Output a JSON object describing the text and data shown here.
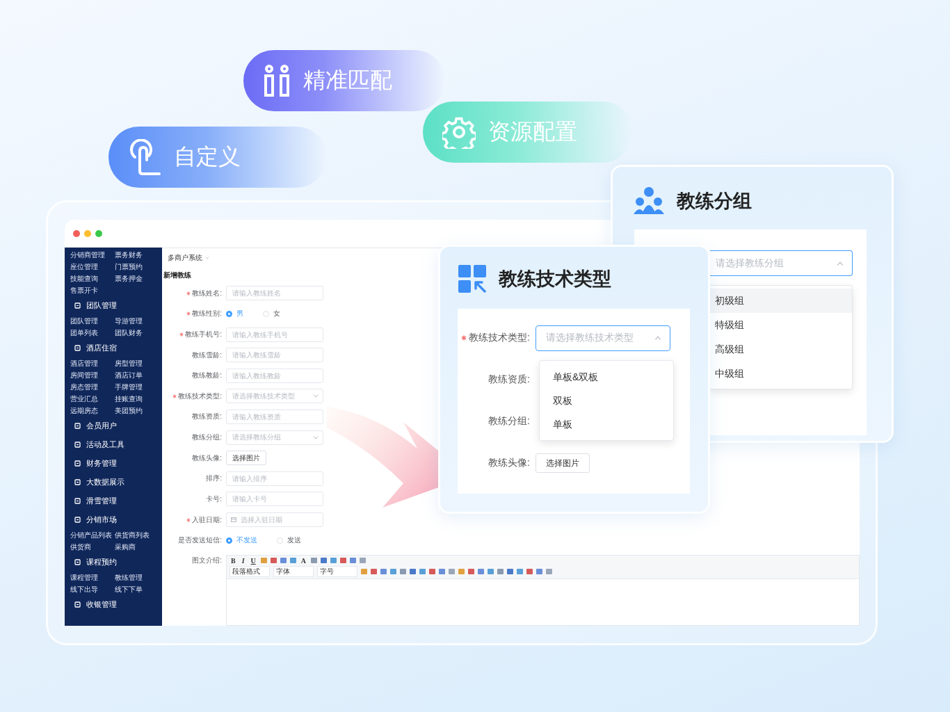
{
  "badges": [
    {
      "kind": "match",
      "label": "精准匹配"
    },
    {
      "kind": "gear",
      "label": "资源配置"
    },
    {
      "kind": "touch",
      "label": "自定义"
    }
  ],
  "app": {
    "sidebar": [
      {
        "items": [
          "分销商管理",
          "票务财务",
          "座位管理",
          "门票预约",
          "技能查询",
          "票务押金",
          "售票开卡"
        ]
      },
      {
        "title": "团队管理",
        "items": [
          "团队管理",
          "导游管理",
          "团单列表",
          "团队财务"
        ]
      },
      {
        "title": "酒店住宿",
        "items": [
          "酒店管理",
          "房型管理",
          "房间管理",
          "酒店订单",
          "房态管理",
          "手牌管理",
          "营业汇总",
          "挂账查询",
          "远期房态",
          "美团预约"
        ]
      },
      {
        "title": "会员用户"
      },
      {
        "title": "活动及工具"
      },
      {
        "title": "财务管理"
      },
      {
        "title": "大数据展示"
      },
      {
        "title": "滑雪管理"
      },
      {
        "title": "分销市场",
        "items": [
          "分销产品列表",
          "供货商列表",
          "供货商",
          "采购商"
        ]
      },
      {
        "title": "课程预约",
        "items": [
          "课程管理",
          "教练管理",
          "线下出导",
          "线下下单"
        ]
      },
      {
        "title": "收银管理"
      }
    ],
    "system": "多商户系统",
    "form": {
      "title": "新增教练",
      "fields": [
        {
          "kind": "input",
          "label": "教练姓名:",
          "required": true,
          "placeholder": "请输入教练姓名"
        },
        {
          "kind": "radio",
          "label": "教练性别:",
          "required": true,
          "options": [
            {
              "label": "男",
              "selected": true
            },
            {
              "label": "女",
              "selected": false
            }
          ]
        },
        {
          "kind": "input",
          "label": "教练手机号:",
          "required": true,
          "placeholder": "请输入教练手机号"
        },
        {
          "kind": "input",
          "label": "教练雪龄:",
          "required": false,
          "placeholder": "请输入教练雪龄"
        },
        {
          "kind": "input",
          "label": "教练教龄:",
          "required": false,
          "placeholder": "请输入教练教龄"
        },
        {
          "kind": "select",
          "label": "教练技术类型:",
          "required": true,
          "placeholder": "请选择教练技术类型"
        },
        {
          "kind": "input",
          "label": "教练资质:",
          "required": false,
          "placeholder": "请输入教练资质"
        },
        {
          "kind": "select",
          "label": "教练分组:",
          "required": false,
          "placeholder": "请选择教练分组"
        },
        {
          "kind": "button",
          "label": "教练头像:",
          "required": false,
          "button": "选择图片"
        },
        {
          "kind": "input",
          "label": "排序:",
          "required": false,
          "placeholder": "请输入排序"
        },
        {
          "kind": "input",
          "label": "卡号:",
          "required": false,
          "placeholder": "请输入卡号"
        },
        {
          "kind": "date",
          "label": "入驻日期:",
          "required": true,
          "placeholder": "选择入驻日期"
        },
        {
          "kind": "radio",
          "label": "是否发送短信:",
          "required": false,
          "options": [
            {
              "label": "不发送",
              "selected": true
            },
            {
              "label": "发送",
              "selected": false
            }
          ]
        },
        {
          "kind": "editor",
          "label": "图文介绍:",
          "required": false,
          "buttons": [
            "B",
            "I",
            "U",
            "A"
          ],
          "selects": [
            "段落格式",
            "字体",
            "字号"
          ]
        }
      ]
    }
  },
  "tech_card": {
    "title": "教练技术类型",
    "fields": [
      {
        "kind": "select",
        "label": "教练技术类型:",
        "required": true,
        "placeholder": "请选择教练技术类型",
        "expanded": true
      },
      {
        "kind": "label",
        "label": "教练资质:",
        "required": false
      },
      {
        "kind": "label",
        "label": "教练分组:",
        "required": false
      },
      {
        "kind": "button",
        "label": "教练头像:",
        "required": false,
        "button": "选择图片"
      }
    ],
    "options": [
      "单板&双板",
      "双板",
      "单板"
    ]
  },
  "group_card": {
    "title": "教练分组",
    "placeholder": "请选择教练分组",
    "expanded": true,
    "options": [
      {
        "label": "初级组",
        "selected": true
      },
      {
        "label": "特级组",
        "selected": false
      },
      {
        "label": "高级组",
        "selected": false
      },
      {
        "label": "中级组",
        "selected": false
      }
    ]
  }
}
